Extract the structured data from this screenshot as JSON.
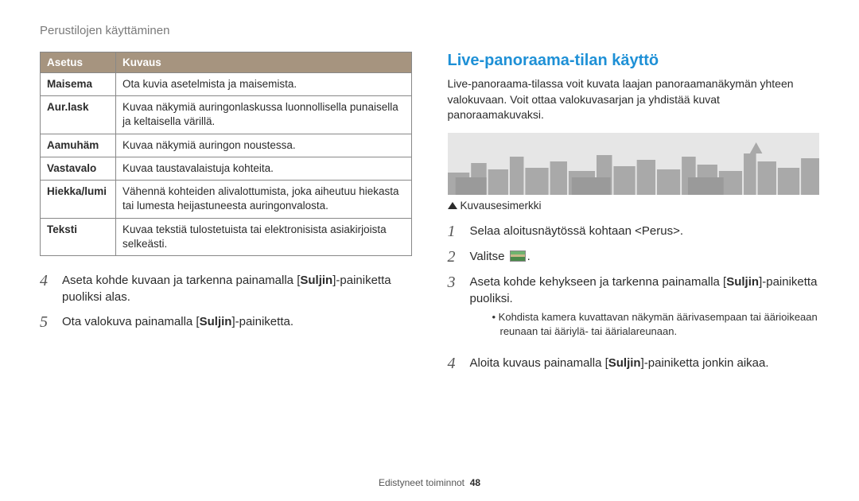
{
  "breadcrumb": "Perustilojen käyttäminen",
  "table": {
    "h1": "Asetus",
    "h2": "Kuvaus",
    "rows": [
      {
        "a": "Maisema",
        "b": "Ota kuvia asetelmista ja maisemista."
      },
      {
        "a": "Aur.lask",
        "b": "Kuvaa näkymiä auringonlaskussa luonnollisella punaisella ja keltaisella värillä."
      },
      {
        "a": "Aamuhäm",
        "b": "Kuvaa näkymiä auringon noustessa."
      },
      {
        "a": "Vastavalo",
        "b": "Kuvaa taustavalaistuja kohteita."
      },
      {
        "a": "Hiekka/lumi",
        "b": "Vähennä kohteiden alivalottumista, joka aiheutuu hiekasta tai lumesta heijastuneesta auringonvalosta."
      },
      {
        "a": "Teksti",
        "b": "Kuvaa tekstiä tulostetuista tai elektronisista asiakirjoista selkeästi."
      }
    ]
  },
  "left_steps": {
    "s4a": "Aseta kohde kuvaan ja tarkenna painamalla [",
    "s4b": "Suljin",
    "s4c": "]-painiketta puoliksi alas.",
    "s5a": "Ota valokuva painamalla [",
    "s5b": "Suljin",
    "s5c": "]-painiketta."
  },
  "right": {
    "title": "Live-panoraama-tilan käyttö",
    "intro": "Live-panoraama-tilassa voit kuvata laajan panoraamanäkymän yhteen valokuvaan. Voit ottaa valokuvasarjan ja yhdistää kuvat panoraamakuvaksi.",
    "caption": "Kuvausesimerkki",
    "s1a": "Selaa aloitusnäytössä kohtaan ",
    "s1b": "<Perus>",
    "s1c": ".",
    "s2a": "Valitse ",
    "s2b": ".",
    "s3a": "Aseta kohde kehykseen ja tarkenna painamalla [",
    "s3b": "Suljin",
    "s3c": "]-painiketta puoliksi.",
    "s3_sub": "Kohdista kamera kuvattavan näkymän äärivasempaan tai äärioikeaan reunaan tai ääriylä- tai äärialareunaan.",
    "s4a": "Aloita kuvaus painamalla [",
    "s4b": "Suljin",
    "s4c": "]-painiketta jonkin aikaa."
  },
  "nums": {
    "n1": "1",
    "n2": "2",
    "n3": "3",
    "n4": "4",
    "n5": "5"
  },
  "footer": {
    "label": "Edistyneet toiminnot",
    "page": "48"
  }
}
